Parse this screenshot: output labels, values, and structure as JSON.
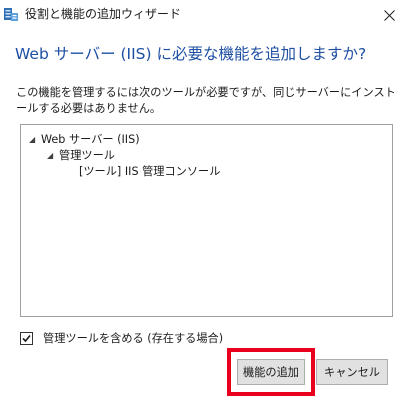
{
  "window": {
    "title": "役割と機能の追加ウィザード",
    "app_icon": "server-manager-icon",
    "close_icon": "close-icon"
  },
  "dialog": {
    "heading": "Web サーバー (IIS) に必要な機能を追加しますか?",
    "description": "この機能を管理するには次のツールが必要ですが、同じサーバーにインストールする必要はありません。"
  },
  "tree": {
    "items": [
      {
        "label": "Web サーバー (IIS)",
        "expanded": true,
        "level": 0
      },
      {
        "label": "管理ツール",
        "expanded": true,
        "level": 1
      },
      {
        "label": "[ツール] IIS 管理コンソール",
        "level": 2
      }
    ],
    "expand_glyph": "◢"
  },
  "options": {
    "include_tools_label": "管理ツールを含める (存在する場合)",
    "include_tools_checked": true
  },
  "buttons": {
    "add_features_label": "機能の追加",
    "cancel_label": "キャンセル"
  },
  "colors": {
    "heading": "#1e4fa3",
    "highlight": "#e8001c",
    "button_face": "#e1e1e1"
  }
}
